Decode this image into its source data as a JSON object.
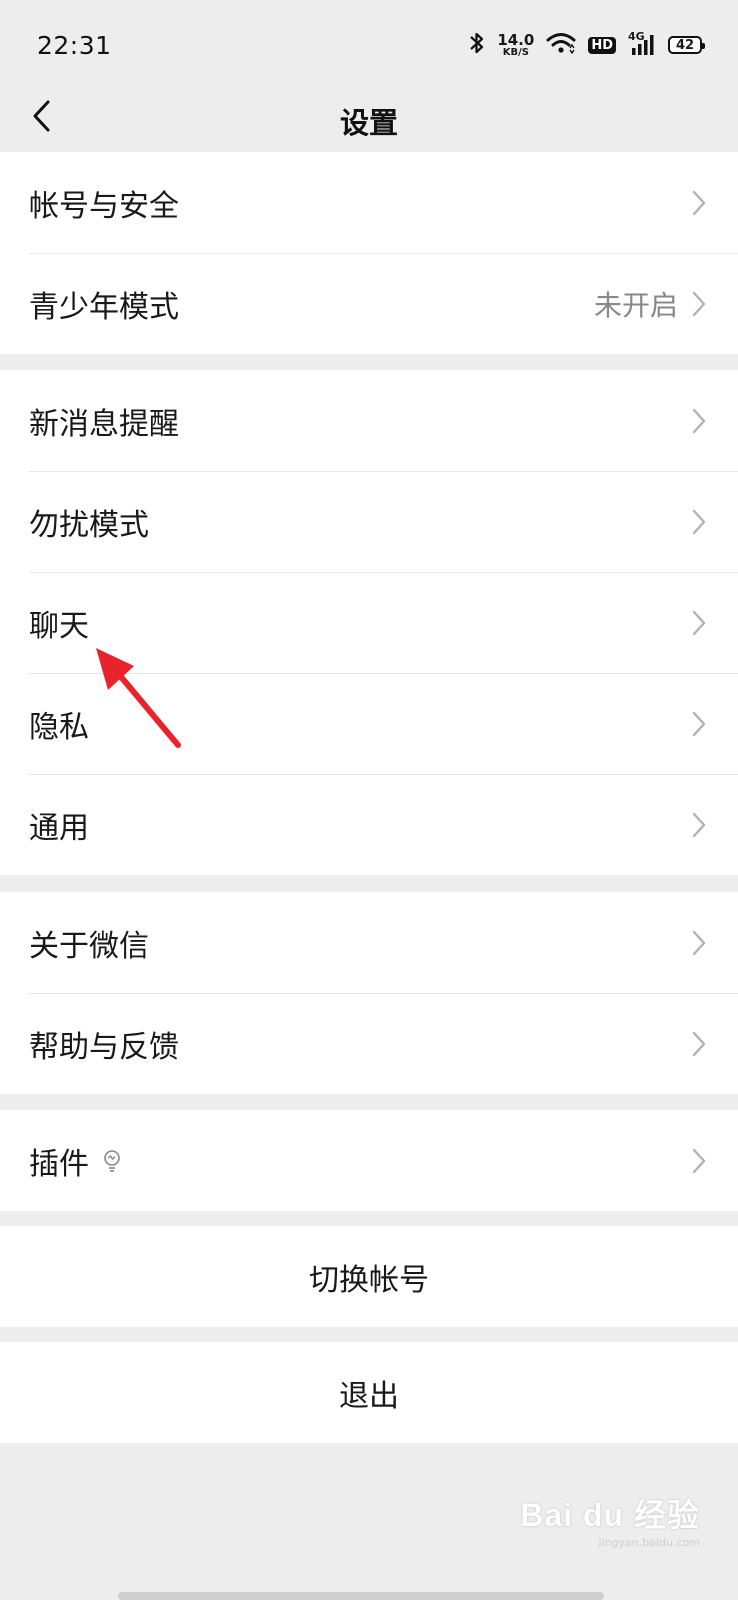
{
  "status_bar": {
    "time": "22:31",
    "net_speed_value": "14.0",
    "net_speed_unit": "KB/S",
    "hd_label": "HD",
    "network_label": "4G",
    "battery_level": "42"
  },
  "header": {
    "title": "设置"
  },
  "groups": [
    {
      "items": [
        {
          "label": "帐号与安全",
          "value": ""
        },
        {
          "label": "青少年模式",
          "value": "未开启"
        }
      ]
    },
    {
      "items": [
        {
          "label": "新消息提醒",
          "value": ""
        },
        {
          "label": "勿扰模式",
          "value": ""
        },
        {
          "label": "聊天",
          "value": ""
        },
        {
          "label": "隐私",
          "value": ""
        },
        {
          "label": "通用",
          "value": ""
        }
      ]
    },
    {
      "items": [
        {
          "label": "关于微信",
          "value": ""
        },
        {
          "label": "帮助与反馈",
          "value": ""
        }
      ]
    },
    {
      "items": [
        {
          "label": "插件",
          "value": ""
        }
      ]
    }
  ],
  "actions": {
    "switch_account": "切换帐号",
    "logout": "退出"
  },
  "watermark": {
    "logo": "Bai du 经验",
    "sub": "jingyan.baidu.com"
  },
  "colors": {
    "background": "#ededed",
    "annotation_arrow": "#e8232b"
  }
}
